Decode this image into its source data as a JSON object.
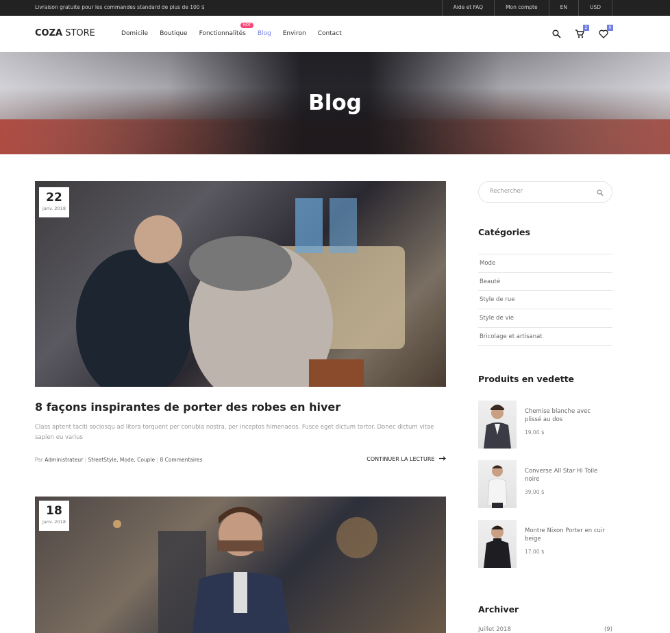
{
  "topbar": {
    "promo": "Livraison gratuite pour les commandes standard de plus de 100 $",
    "links": [
      "Aide et FAQ",
      "Mon compte",
      "EN",
      "USD"
    ]
  },
  "header": {
    "logo_bold": "COZA",
    "logo_rest": " STORE",
    "nav": [
      "Domicile",
      "Boutique",
      "Fonctionnalités",
      "Blog",
      "Environ",
      "Contact"
    ],
    "hot_label": "HOT",
    "cart_count": "2",
    "wishlist_count": "0"
  },
  "hero": {
    "title": "Blog"
  },
  "posts": [
    {
      "day": "22",
      "month": "janv. 2018",
      "title": "8 façons inspirantes de porter des robes en hiver",
      "excerpt": "Class aptent taciti sociosqu ad litora torquent per conubia nostra, per inceptos himenaeos. Fusce eget dictum tortor. Donec dictum vitae sapien eu varius",
      "by": "Par",
      "author": "Administrateur",
      "tags": "StreetStyle, Mode, Couple",
      "comments": "8 Commentaires",
      "more": "CONTINUER LA LECTURE"
    },
    {
      "day": "18",
      "month": "janv. 2018"
    }
  ],
  "sidebar": {
    "search_placeholder": "Rechercher",
    "categories_title": "Catégories",
    "categories": [
      "Mode",
      "Beauté",
      "Style de rue",
      "Style de vie",
      "Bricolage et artisanat"
    ],
    "featured_title": "Produits en vedette",
    "products": [
      {
        "name": "Chemise blanche avec plissé au dos",
        "price": "19,00 $"
      },
      {
        "name": "Converse All Star Hi Toile noire",
        "price": "39,00 $"
      },
      {
        "name": "Montre Nixon Porter en cuir beige",
        "price": "17,00 $"
      }
    ],
    "archive_title": "Archiver",
    "archive": [
      {
        "label": "Juillet 2018",
        "count": "(9)"
      }
    ]
  },
  "colors": {
    "accent": "#717fe0",
    "hot": "#f74877",
    "topbar": "#222222"
  }
}
